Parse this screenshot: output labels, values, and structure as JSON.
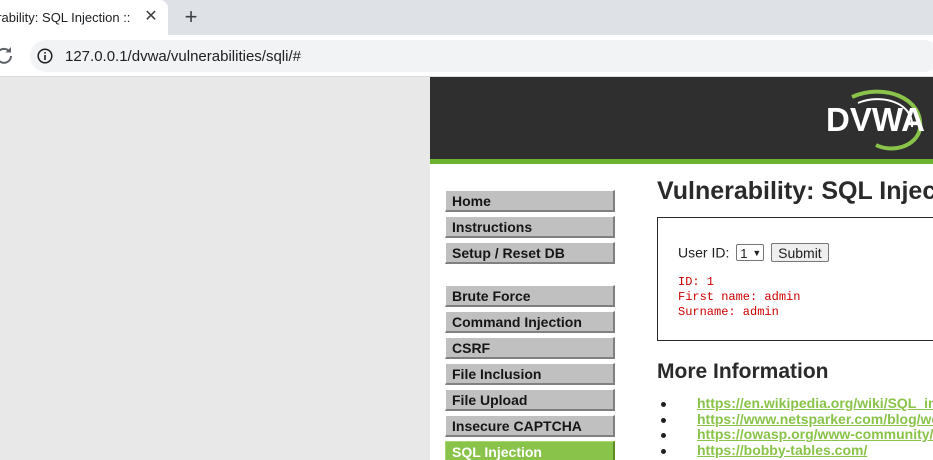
{
  "browser": {
    "tab_title": "erability: SQL Injection :: ",
    "tab_close": "✕",
    "new_tab": "+",
    "url": "127.0.0.1/dvwa/vulnerabilities/sqli/#"
  },
  "logo": {
    "text": "DVWA"
  },
  "menu": {
    "group1": [
      "Home",
      "Instructions",
      "Setup / Reset DB"
    ],
    "group2": [
      "Brute Force",
      "Command Injection",
      "CSRF",
      "File Inclusion",
      "File Upload",
      "Insecure CAPTCHA",
      "SQL Injection"
    ],
    "selected": "SQL Injection"
  },
  "main": {
    "title": "Vulnerability: SQL Injection",
    "form": {
      "label": "User ID:",
      "selected_value": "1",
      "submit_label": "Submit"
    },
    "result": {
      "line1": "ID: 1",
      "line2": "First name: admin",
      "line3": "Surname: admin"
    },
    "more_title": "More Information",
    "links": [
      "https://en.wikipedia.org/wiki/SQL_injection",
      "https://www.netsparker.com/blog/web-security/sql-injection-cheat-sheet/",
      "https://owasp.org/www-community/attacks/SQL_Injection",
      "https://bobby-tables.com/"
    ]
  },
  "colors": {
    "accent_green": "#8ac34a",
    "header_dark": "#2f2f2f",
    "result_red": "#cc0000"
  }
}
